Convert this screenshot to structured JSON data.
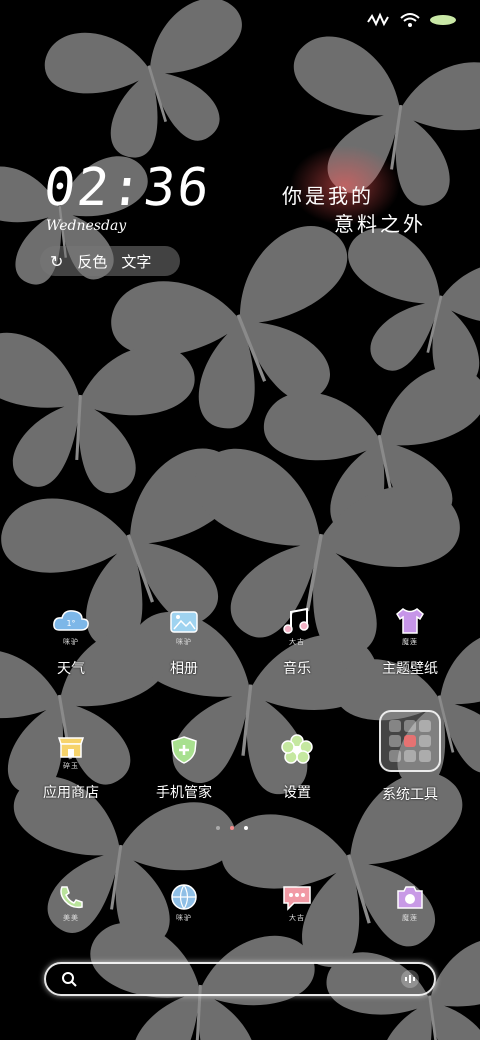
{
  "clock": {
    "time": "02:36",
    "weekday": "Wednesday"
  },
  "widget": {
    "buttons": [
      "反色",
      "文字"
    ]
  },
  "quote": {
    "line1": "你是我的",
    "line2": "意料之外"
  },
  "apps": {
    "row1": [
      {
        "label": "天气",
        "tag": "咪驴"
      },
      {
        "label": "相册",
        "tag": "咪驴"
      },
      {
        "label": "音乐",
        "tag": "大吉"
      },
      {
        "label": "主题壁纸",
        "tag": "魔莲"
      }
    ],
    "row2": [
      {
        "label": "应用商店",
        "tag": "碎玉"
      },
      {
        "label": "手机管家",
        "tag": ""
      },
      {
        "label": "设置",
        "tag": ""
      },
      {
        "label": "系统工具",
        "tag": ""
      }
    ]
  },
  "dock": [
    {
      "tag": "美美"
    },
    {
      "tag": "咪驴"
    },
    {
      "tag": "大吉"
    },
    {
      "tag": "魔莲"
    }
  ],
  "colors": {
    "accent_red": "#ff5a5a",
    "butterfly": "#6e6e6e",
    "background": "#000000"
  }
}
